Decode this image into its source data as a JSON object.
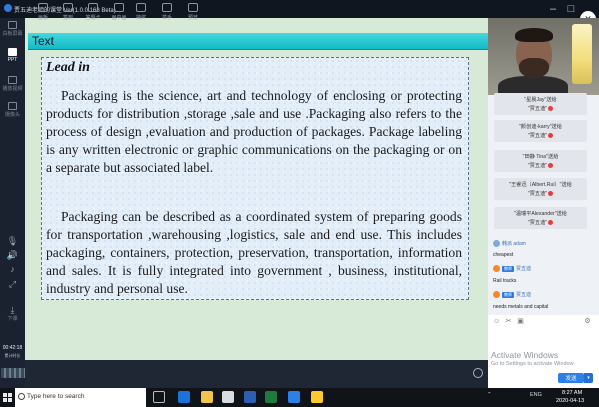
{
  "window": {
    "title": "贾五迪老师的课堂 Ver(1.0.0.168 Beta)"
  },
  "left_toolbar": {
    "items": [
      {
        "label": "白板屏幕"
      },
      {
        "label": "PPT"
      },
      {
        "label": "播放视频"
      },
      {
        "label": "摄像头"
      }
    ],
    "time": "00:42:18",
    "sub_label": "累计时长",
    "download_label": "下课"
  },
  "slide": {
    "header_title": "Text",
    "lead": "Lead in",
    "paragraph1": "Packaging is the science, art and technology of enclosing or protecting products for distribution ,storage ,sale and use .Packaging also refers to the process of design ,evaluation and production of packages. Package labeling is any written electronic or graphic communications on the packaging or  on a separate but associated label.",
    "paragraph2": "Packaging can be described as a coordinated system of preparing goods for transportation ,warehousing ,logistics, sale and end use. This includes packaging, containers, protection, preservation, transportation, information and sales. It is fully integrated into government , business, institutional, industry and personal use."
  },
  "bottom_toolbar": {
    "items": [
      {
        "label": "画板"
      },
      {
        "label": "签到"
      },
      {
        "label": "答题卡"
      },
      {
        "label": "画中画"
      },
      {
        "label": "抽奖"
      },
      {
        "label": "举手"
      },
      {
        "label": "预览"
      }
    ]
  },
  "chat": {
    "gifts": [
      {
        "line1": "\"星晨Jay\"送给",
        "line2": "\"贾五迪\""
      },
      {
        "line1": "\"颜创迪-karry\"送给",
        "line2": "\"贾五迪\""
      },
      {
        "line1": "\"田静 Tina\"送给",
        "line2": "\"贾五迪\""
      },
      {
        "line1": "\"王睿迅（Albert.Rui）\"送给",
        "line2": "\"贾五迪\""
      },
      {
        "line1": "\"温瑞平Alexander\"送给",
        "line2": "\"贾五迪\""
      }
    ],
    "messages": [
      {
        "sender": "韩派 adam",
        "badge": "",
        "text": "cheapest"
      },
      {
        "sender": "贾五迪",
        "badge": "教师",
        "text": "Rail tracks"
      },
      {
        "sender": "贾五迪",
        "badge": "教师",
        "text": "needs metals and capital"
      }
    ],
    "input_value": "",
    "send_label": "发送"
  },
  "activation": {
    "line1": "Activate Windows",
    "line2": "Go to Settings to activate Window"
  },
  "taskbar": {
    "search_placeholder": "Type here to search",
    "tray_lang": "ENG",
    "time": "8:27 AM",
    "date": "2020-04-13"
  },
  "colors": {
    "slide_header": "#13b9c5",
    "send_button": "#2c80e8",
    "heart": "#e53d3d"
  }
}
